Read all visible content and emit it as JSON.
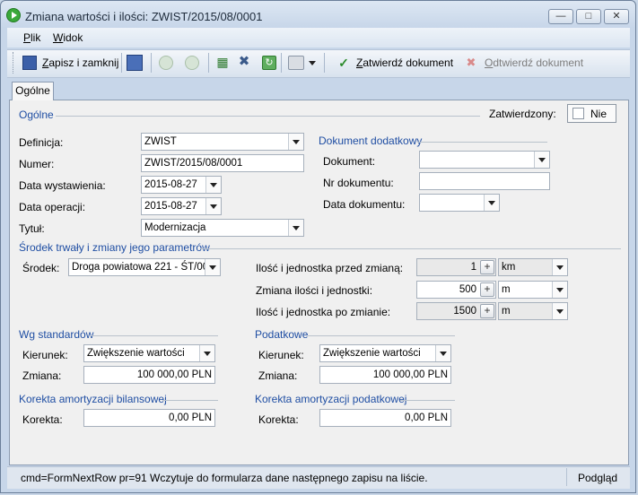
{
  "window": {
    "title": "Zmiana wartości i ilości: ZWIST/2015/08/0001"
  },
  "menu": {
    "file_prefix": "P",
    "file_rest": "lik",
    "view_prefix": "W",
    "view_rest": "idok"
  },
  "toolbar": {
    "save_close_prefix": "Z",
    "save_close_rest": "apisz i zamknij",
    "confirm_prefix": "Z",
    "confirm_rest": "atwierdź dokument",
    "unconfirm_prefix": "O",
    "unconfirm_rest": "dtwierdź dokument"
  },
  "tabs": {
    "general": "Ogólne"
  },
  "general": {
    "section": "Ogólne",
    "confirmed_label": "Zatwierdzony:",
    "confirmed_value": "Nie",
    "definition_label": "Definicja:",
    "definition_value": "ZWIST",
    "number_label": "Numer:",
    "number_value": "ZWIST/2015/08/0001",
    "issue_date_label": "Data wystawienia:",
    "issue_date_value": "2015-08-27",
    "operation_date_label": "Data operacji:",
    "operation_date_value": "2015-08-27",
    "title_label": "Tytuł:",
    "title_value": "Modernizacja"
  },
  "additional_doc": {
    "section": "Dokument dodatkowy",
    "document_label": "Dokument:",
    "document_value": "",
    "doc_number_label": "Nr dokumentu:",
    "doc_number_value": "",
    "doc_date_label": "Data dokumentu:",
    "doc_date_value": ""
  },
  "asset": {
    "section": "Środek trwały i zmiany jego parametrów",
    "asset_label": "Środek:",
    "asset_value": "Droga powiatowa 221 - ŚT/00(",
    "qty_before_label": "Ilość i jednostka przed zmianą:",
    "qty_before_value": "1",
    "unit_before": "km",
    "qty_change_label": "Zmiana ilości i jednostki:",
    "qty_change_value": "500",
    "unit_change": "m",
    "qty_after_label": "Ilość i jednostka po zmianie:",
    "qty_after_value": "1500",
    "unit_after": "m"
  },
  "standards": {
    "section": "Wg standardów",
    "direction_label": "Kierunek:",
    "direction_value": "Zwiększenie wartości",
    "change_label": "Zmiana:",
    "change_value": "100 000,00 PLN"
  },
  "tax": {
    "section": "Podatkowe",
    "direction_label": "Kierunek:",
    "direction_value": "Zwiększenie wartości",
    "change_label": "Zmiana:",
    "change_value": "100 000,00 PLN"
  },
  "balance_correction": {
    "section": "Korekta amortyzacji bilansowej",
    "label": "Korekta:",
    "value": "0,00 PLN"
  },
  "tax_correction": {
    "section": "Korekta amortyzacji podatkowej",
    "label": "Korekta:",
    "value": "0,00 PLN"
  },
  "status": {
    "message": "cmd=FormNextRow pr=91 Wczytuje do formularza dane następnego zapisu na liście.",
    "preview": "Podgląd"
  },
  "colors": {
    "section_title": "#1f4ea3",
    "window_bg": "#c9d7e8",
    "panel_bg": "#f0f0f0"
  }
}
